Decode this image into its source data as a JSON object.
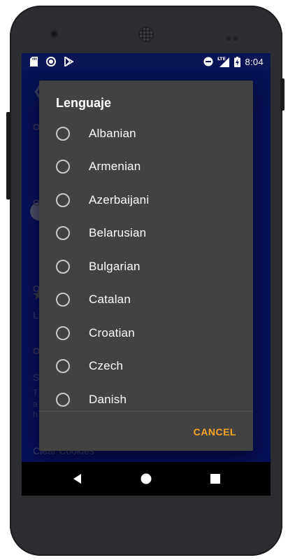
{
  "status_bar": {
    "time": "8:04",
    "network": "LTE",
    "icons": [
      "sd-card-icon",
      "record-icon",
      "play-store-icon",
      "do-not-disturb-icon",
      "signal-icon",
      "battery-charging-icon"
    ]
  },
  "background_app": {
    "row_labels": [
      "O",
      "O",
      "O",
      "L",
      "O",
      "S",
      "T",
      "a",
      "h"
    ],
    "clear_cookies_label": "Clear Cookies"
  },
  "dialog": {
    "title": "Lenguaje",
    "options": [
      {
        "label": "Albanian",
        "selected": false
      },
      {
        "label": "Armenian",
        "selected": false
      },
      {
        "label": "Azerbaijani",
        "selected": false
      },
      {
        "label": "Belarusian",
        "selected": false
      },
      {
        "label": "Bulgarian",
        "selected": false
      },
      {
        "label": "Catalan",
        "selected": false
      },
      {
        "label": "Croatian",
        "selected": false
      },
      {
        "label": "Czech",
        "selected": false
      },
      {
        "label": "Danish",
        "selected": false
      }
    ],
    "cancel_label": "CANCEL"
  },
  "colors": {
    "accent": "#F6A623",
    "dialog_background": "#424242",
    "app_primary": "#0D1CA3"
  }
}
